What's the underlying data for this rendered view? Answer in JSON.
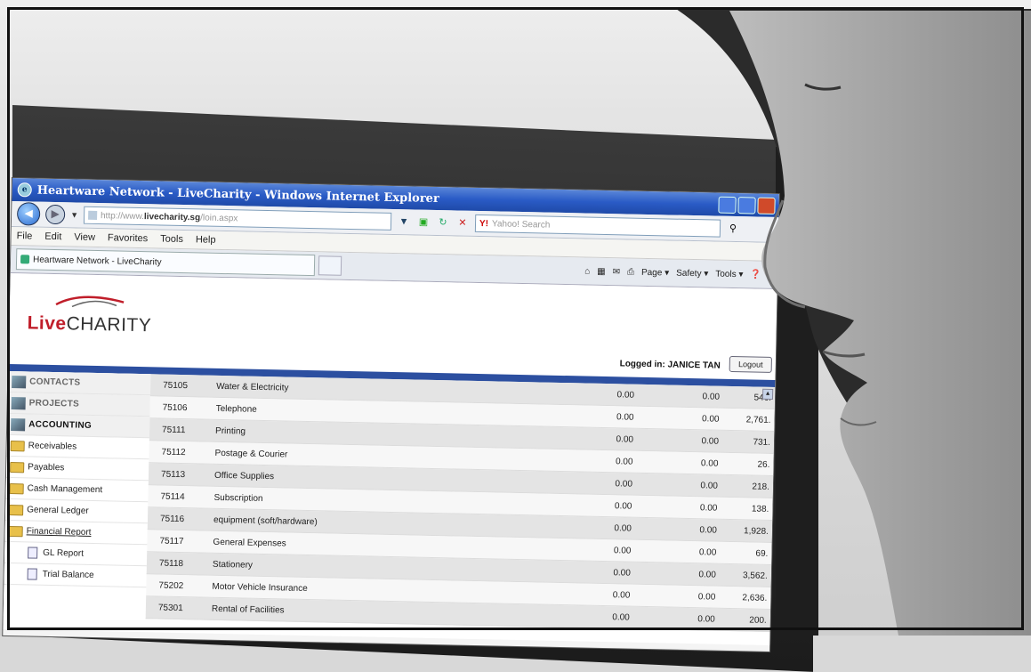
{
  "window": {
    "title": "Heartware Network - LiveCharity - Windows Internet Explorer"
  },
  "address": {
    "url_prefix": "http://www.",
    "url_domain": "livecharity.sg",
    "url_suffix": "/loin.aspx"
  },
  "search": {
    "placeholder": "Yahoo! Search"
  },
  "menu": [
    "File",
    "Edit",
    "View",
    "Favorites",
    "Tools",
    "Help"
  ],
  "tab": {
    "label": "Heartware Network - LiveCharity"
  },
  "command_bar": {
    "page": "Page ▾",
    "safety": "Safety ▾",
    "tools": "Tools ▾"
  },
  "app": {
    "logo_live": "Live",
    "logo_charity": "CHARITY",
    "logged_in": "Logged in: JANICE TAN",
    "logout": "Logout"
  },
  "sidebar": [
    {
      "label": "CONTACTS",
      "type": "section"
    },
    {
      "label": "PROJECTS",
      "type": "section"
    },
    {
      "label": "ACCOUNTING",
      "type": "section",
      "active": true
    },
    {
      "label": "Receivables",
      "type": "folder"
    },
    {
      "label": "Payables",
      "type": "folder"
    },
    {
      "label": "Cash Management",
      "type": "folder"
    },
    {
      "label": "General Ledger",
      "type": "folder"
    },
    {
      "label": "Financial Report",
      "type": "folder",
      "underline": true
    },
    {
      "label": "GL Report",
      "type": "sub"
    },
    {
      "label": "Trial Balance",
      "type": "sub"
    }
  ],
  "table": {
    "rows": [
      {
        "code": "75105",
        "name": "Water & Electricity",
        "a": "0.00",
        "b": "0.00",
        "c": "546."
      },
      {
        "code": "75106",
        "name": "Telephone",
        "a": "0.00",
        "b": "0.00",
        "c": "2,761."
      },
      {
        "code": "75111",
        "name": "Printing",
        "a": "0.00",
        "b": "0.00",
        "c": "731."
      },
      {
        "code": "75112",
        "name": "Postage & Courier",
        "a": "0.00",
        "b": "0.00",
        "c": "26."
      },
      {
        "code": "75113",
        "name": "Office Supplies",
        "a": "0.00",
        "b": "0.00",
        "c": "218."
      },
      {
        "code": "75114",
        "name": "Subscription",
        "a": "0.00",
        "b": "0.00",
        "c": "138."
      },
      {
        "code": "75116",
        "name": "equipment (soft/hardware)",
        "a": "0.00",
        "b": "0.00",
        "c": "1,928."
      },
      {
        "code": "75117",
        "name": "General Expenses",
        "a": "0.00",
        "b": "0.00",
        "c": "69."
      },
      {
        "code": "75118",
        "name": "Stationery",
        "a": "0.00",
        "b": "0.00",
        "c": "3,562."
      },
      {
        "code": "75202",
        "name": "Motor Vehicle Insurance",
        "a": "0.00",
        "b": "0.00",
        "c": "2,636."
      },
      {
        "code": "75301",
        "name": "Rental of Facilities",
        "a": "0.00",
        "b": "0.00",
        "c": "200."
      }
    ]
  },
  "colors": {
    "titlebar": "#2a5bc6",
    "accent_bar": "#2c4fa0",
    "logo_red": "#c01e2a"
  }
}
